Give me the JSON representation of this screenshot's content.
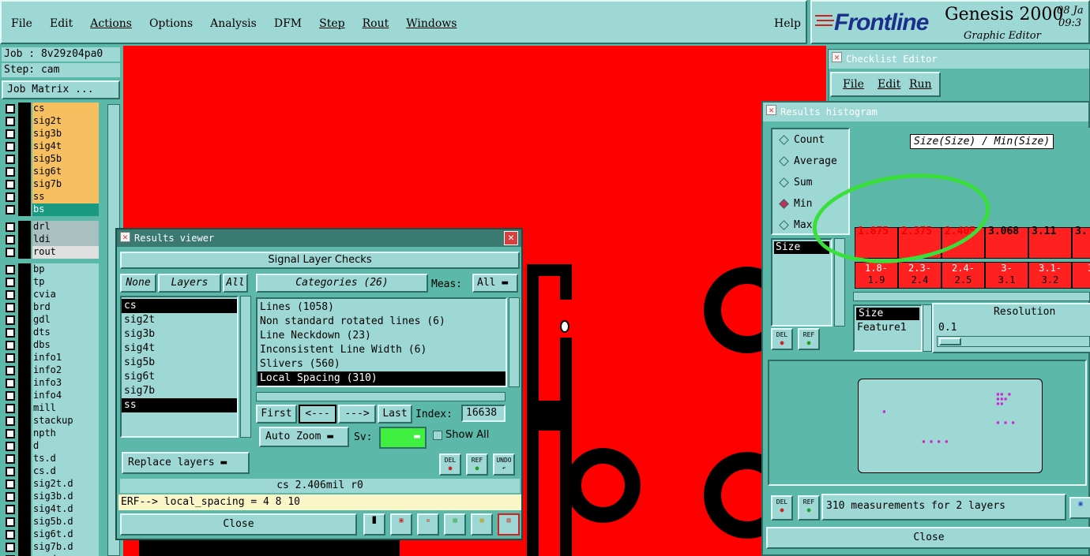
{
  "menubar": {
    "items": [
      "File",
      "Edit",
      "Actions",
      "Options",
      "Analysis",
      "DFM",
      "Step",
      "Rout",
      "Windows"
    ],
    "help": "Help"
  },
  "brand": {
    "logo": "Frontline",
    "product": "Genesis 2000",
    "subtitle": "Graphic Editor",
    "date": "08 Ja",
    "time": "09:3"
  },
  "job": {
    "job_label": "Job : 8v29z04pa0",
    "step_label": "Step: cam",
    "matrix_button": "Job Matrix ..."
  },
  "layers": [
    {
      "name": "cs",
      "color": "#f6c060"
    },
    {
      "name": "sig2t",
      "color": "#f6c060"
    },
    {
      "name": "sig3b",
      "color": "#f6c060"
    },
    {
      "name": "sig4t",
      "color": "#f6c060"
    },
    {
      "name": "sig5b",
      "color": "#f6c060"
    },
    {
      "name": "sig6t",
      "color": "#f6c060"
    },
    {
      "name": "sig7b",
      "color": "#f6c060"
    },
    {
      "name": "ss",
      "color": "#f6c060"
    },
    {
      "name": "bs",
      "color": "#1a9a80"
    },
    {
      "name": "drl",
      "color": "#a8c0c0"
    },
    {
      "name": "ldi",
      "color": "#a8c0c0"
    },
    {
      "name": "rout",
      "color": "#e0e0e0"
    },
    {
      "name": "bp",
      "color": "#9ed8d4"
    },
    {
      "name": "tp",
      "color": "#9ed8d4"
    },
    {
      "name": "cvia",
      "color": "#9ed8d4"
    },
    {
      "name": "brd",
      "color": "#9ed8d4"
    },
    {
      "name": "gdl",
      "color": "#9ed8d4"
    },
    {
      "name": "dts",
      "color": "#9ed8d4"
    },
    {
      "name": "dbs",
      "color": "#9ed8d4"
    },
    {
      "name": "info1",
      "color": "#9ed8d4"
    },
    {
      "name": "info2",
      "color": "#9ed8d4"
    },
    {
      "name": "info3",
      "color": "#9ed8d4"
    },
    {
      "name": "info4",
      "color": "#9ed8d4"
    },
    {
      "name": "mill",
      "color": "#9ed8d4"
    },
    {
      "name": "stackup",
      "color": "#9ed8d4"
    },
    {
      "name": "npth",
      "color": "#9ed8d4"
    },
    {
      "name": "d",
      "color": "#9ed8d4"
    },
    {
      "name": "ts.d",
      "color": "#9ed8d4"
    },
    {
      "name": "cs.d",
      "color": "#9ed8d4"
    },
    {
      "name": "sig2t.d",
      "color": "#9ed8d4"
    },
    {
      "name": "sig3b.d",
      "color": "#9ed8d4"
    },
    {
      "name": "sig4t.d",
      "color": "#9ed8d4"
    },
    {
      "name": "sig5b.d",
      "color": "#9ed8d4"
    },
    {
      "name": "sig6t.d",
      "color": "#9ed8d4"
    },
    {
      "name": "sig7b.d",
      "color": "#9ed8d4"
    },
    {
      "name": "cs.d",
      "color": "#9ed8d4"
    }
  ],
  "results_viewer": {
    "title": "Results viewer",
    "header": "Signal Layer Checks",
    "none_btn": "None",
    "layers_btn": "Layers",
    "all_btn": "All",
    "layer_list": [
      "cs",
      "sig2t",
      "sig3b",
      "sig4t",
      "sig5b",
      "sig6t",
      "sig7b",
      "ss"
    ],
    "categories_btn": "Categories (26)",
    "meas_label": "Meas:",
    "meas_value": "All",
    "categories": [
      "Lines (1058)",
      "Non standard rotated lines (6)",
      "Line Neckdown (23)",
      "Inconsistent Line Width (6)",
      "Slivers (560)",
      "Local Spacing (310)"
    ],
    "first": "First",
    "prev": "<---",
    "next": "--->",
    "last": "Last",
    "index_label": "Index:",
    "index_value": "16638",
    "zoom": "Auto Zoom",
    "sv_label": "Sv:",
    "show_all": "Show All",
    "replace": "Replace layers",
    "del": "DEL",
    "ref": "REF",
    "undo": "UNDO",
    "status": "cs 2.406mil  r0",
    "erf": "ERF--> local_spacing = 4 8 10",
    "close": "Close"
  },
  "checklist": {
    "title": "Checklist Editor",
    "menu": [
      "File",
      "Edit",
      "Run"
    ]
  },
  "histogram": {
    "title": "Results histogram",
    "modes": [
      "Count",
      "Average",
      "Sum",
      "Min",
      "Max"
    ],
    "selected_mode": "Min",
    "chart_title": "Size(Size) / Min(Size)",
    "size_label": "Size",
    "bars": [
      {
        "value": "1.875",
        "range": [
          "1.8-",
          "1.9"
        ]
      },
      {
        "value": "2.375",
        "range": [
          "2.3-",
          "2.4"
        ]
      },
      {
        "value": "2.405",
        "range": [
          "2.4-",
          "2.5"
        ]
      },
      {
        "value": "3.068",
        "range": [
          "3-",
          "3.1"
        ]
      },
      {
        "value": "3.11",
        "range": [
          "3.1-",
          "3.2"
        ]
      },
      {
        "value": "3.",
        "range": [
          "3.",
          ""
        ]
      }
    ],
    "field_items": [
      "Size",
      "Feature1"
    ],
    "resolution_label": "Resolution",
    "resolution_value": "0.1",
    "del": "DEL",
    "ref": "REF",
    "status": "310 measurements for 2 layers",
    "close": "Close",
    "accent": "#3ae03a"
  }
}
